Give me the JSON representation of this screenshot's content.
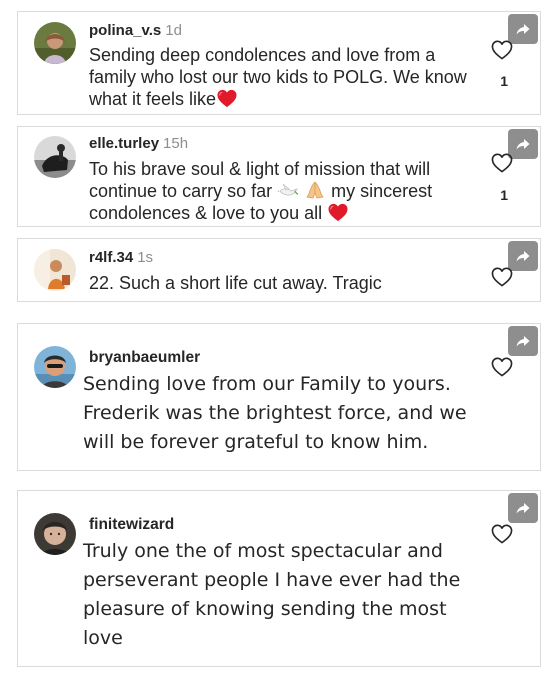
{
  "comments": [
    {
      "username": "polina_v.s",
      "timestamp": "1d",
      "text": "Sending deep condolences and love from a family who lost our two kids to POLG. We know what it feels like",
      "trailing_emoji": "red-heart",
      "likes": "1"
    },
    {
      "username": "elle.turley",
      "timestamp": "15h",
      "text_part1": "To his brave soul & light of mission that will continue to carry so far",
      "emoji_1": "dove",
      "emoji_2": "folded-hands",
      "text_part2": "my sincerest condolences & love to you all",
      "trailing_emoji": "red-heart",
      "likes": "1"
    },
    {
      "username": "r4lf.34",
      "timestamp": "1s",
      "text": "22. Such a short life cut away. Tragic"
    },
    {
      "username": "bryanbaeumler",
      "text": "Sending love from our Family to yours. Frederik was the brightest force, and we will be forever grateful to know him."
    },
    {
      "username": "finitewizard",
      "text": "Truly one the of most spectacular and perseverant people I have ever had the pleasure of knowing sending the most love"
    }
  ],
  "icons": {
    "share": "share-arrow-icon",
    "like": "heart-outline-icon"
  },
  "colors": {
    "text": "#262626",
    "muted": "#8e8e8e",
    "border": "#dbdbdb",
    "share_bg": "#8e8e8e",
    "heart_emoji": "#e0192b"
  }
}
